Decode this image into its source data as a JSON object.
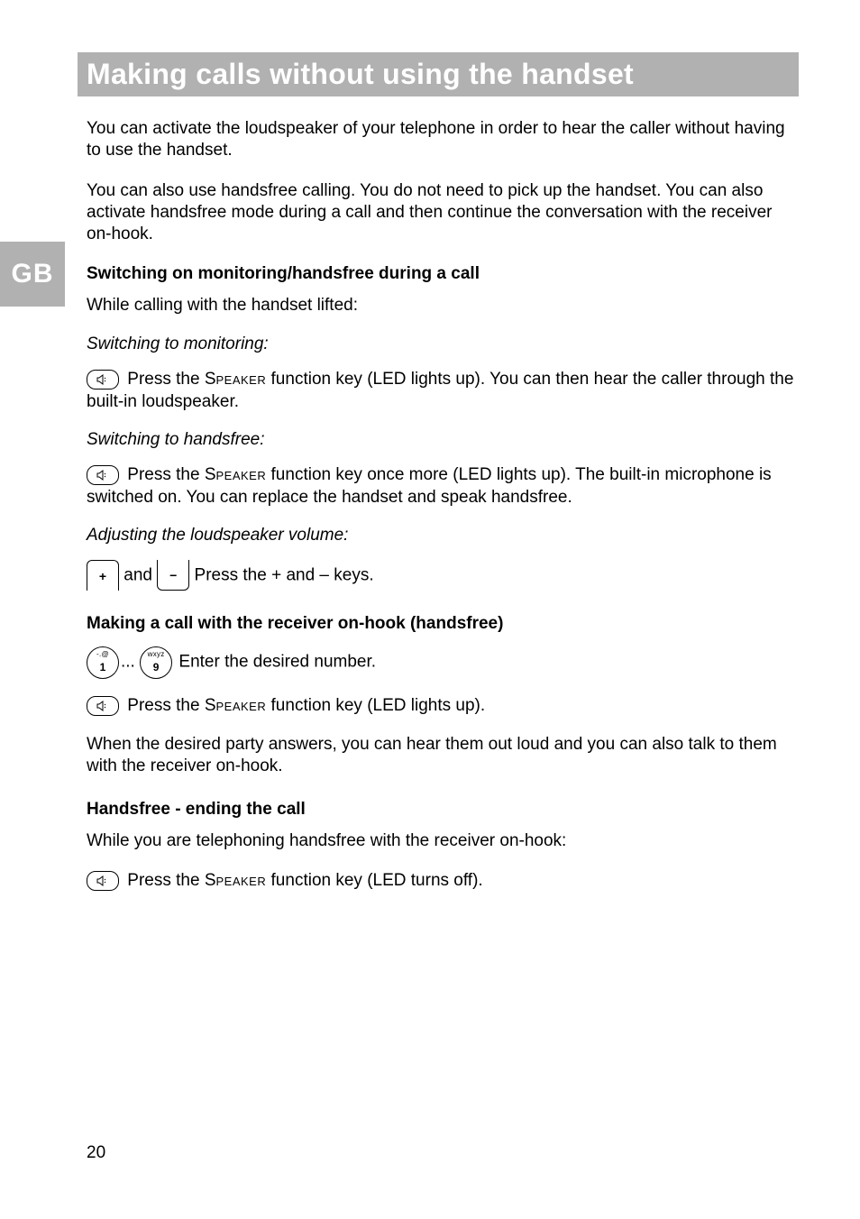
{
  "side_tab": "GB",
  "title": "Making calls without using the handset",
  "p1": "You can activate the loudspeaker of your telephone in order to hear the caller without having to use the handset.",
  "p2": "You can also use handsfree calling. You do not need to pick up the handset. You can also activate handsfree mode during a call and then continue the conversation with the receiver on-hook.",
  "h1": "Switching on monitoring/handsfree during a call",
  "p3": "While calling with the handset lifted:",
  "p4": "Switching to monitoring:",
  "speaker1_a": " Press the S",
  "speaker1_b": "peaker",
  "speaker1_c": " function key (LED lights up). You can then hear the caller through the built-in loudspeaker.",
  "p5": "Switching to handsfree:",
  "speaker2_a": " Press the S",
  "speaker2_b": "peaker",
  "speaker2_c": " function key once more (LED lights up). The built-in microphone is switched on. You can replace the handset and speak handsfree.",
  "p6": "Adjusting the loudspeaker volume:",
  "and_text": " and ",
  "plusminus_text": " Press the + and – keys.",
  "h2": "Making a call with the receiver on-hook (handsfree)",
  "dots": "...",
  "enter_text": " Enter the desired number.",
  "speaker3_a": " Press the S",
  "speaker3_b": "peaker",
  "speaker3_c": " function key (LED lights up).",
  "p7": "When the desired party answers, you can hear them out loud and you can also talk to them with the receiver on-hook.",
  "h3": "Handsfree - ending the call",
  "p8": "While you are telephoning handsfree with the receiver on-hook:",
  "speaker4_a": " Press the S",
  "speaker4_b": "peaker",
  "speaker4_c": " function key (LED turns off).",
  "key1_top": "-.@",
  "key1_bottom": "1",
  "key9_top": "wxyz",
  "key9_bottom": "9",
  "page_num": "20"
}
